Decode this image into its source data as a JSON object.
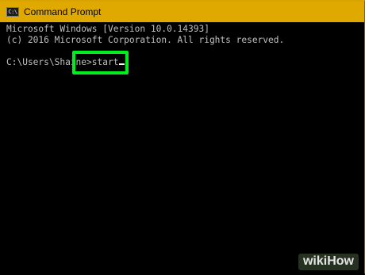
{
  "window": {
    "title": "Command Prompt",
    "icon_label": "C:\\",
    "icon": "console-icon",
    "title_bar_color": "#e0a900"
  },
  "console": {
    "lines": [
      "Microsoft Windows [Version 10.0.14393]",
      "(c) 2016 Microsoft Corporation. All rights reserved."
    ],
    "prompt": "C:\\Users\\Shaine>",
    "command": "start",
    "text_color": "#c0c0c0"
  },
  "highlight": {
    "color": "#00ee1e"
  },
  "watermark": {
    "text": "wikiHow"
  }
}
